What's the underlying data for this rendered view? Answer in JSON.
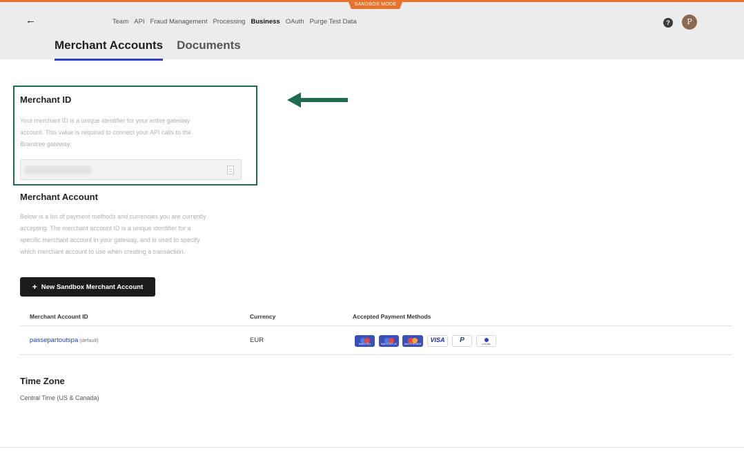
{
  "header": {
    "sandbox_badge": "SANDBOX MODE",
    "back_icon": "arrow-left-icon",
    "nav": [
      "Team",
      "API",
      "Fraud Management",
      "Processing",
      "Business",
      "OAuth",
      "Purge Test Data"
    ],
    "active_nav": "Business",
    "help": "?",
    "avatar_initial": "P",
    "accent_color": "#e8722b"
  },
  "tabs": {
    "merchant_accounts": "Merchant Accounts",
    "documents": "Documents",
    "active_color": "#2c3fc9"
  },
  "merchant_id": {
    "title": "Merchant ID",
    "description": [
      "Your merchant ID is a unique identifier for your entire gateway",
      "account. This value is required to connect your API calls to the",
      "Braintree gateway."
    ],
    "value": ""
  },
  "merchant_account": {
    "title": "Merchant Account",
    "description": [
      "Below is a list of payment methods and currencies you are currently",
      "accepting. The merchant account ID is a unique identifier for a",
      "specific merchant account in your gateway, and is used to specify",
      "which merchant account to use when creating a transaction."
    ],
    "new_button": "New Sandbox Merchant Account"
  },
  "table": {
    "headers": [
      "Merchant Account ID",
      "Currency",
      "Accepted Payment Methods"
    ],
    "rows": [
      {
        "id": "passepartoutspa",
        "default": "(default)",
        "currency": "EUR"
      }
    ],
    "payment_methods": [
      {
        "name": "maestro-icon",
        "label": "MAESTRO"
      },
      {
        "name": "maestro-uk-icon",
        "label": "MAESTRO UK"
      },
      {
        "name": "mastercard-icon",
        "label": "MASTERCARD"
      },
      {
        "name": "visa-icon",
        "label": "VISA"
      },
      {
        "name": "paypal-icon",
        "label": "P"
      },
      {
        "name": "local-payment-icon",
        "label": "LOCAL"
      }
    ]
  },
  "time_zone": {
    "title": "Time Zone",
    "value": "Central Time (US & Canada)"
  },
  "annotation": {
    "color": "#1f6b4d",
    "arrow": "arrow-left-icon"
  }
}
